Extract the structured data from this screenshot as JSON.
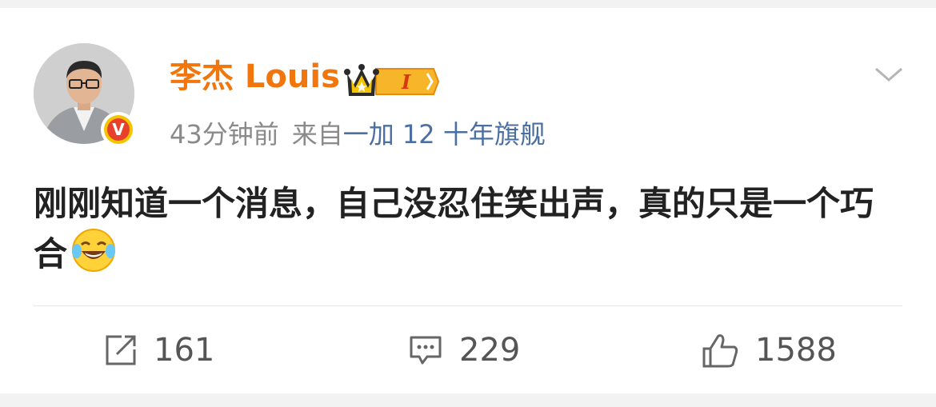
{
  "post": {
    "author": "李杰 Louis",
    "vip_level": "I",
    "time": "43分钟前",
    "source_prefix": "来自",
    "device": "一加 12 十年旗舰",
    "text": "刚刚知道一个消息，自己没忍住笑出声，真的只是一个巧合",
    "verified_badge": "V"
  },
  "actions": {
    "repost_count": "161",
    "comment_count": "229",
    "like_count": "1588"
  },
  "icons": {
    "repost": "share-icon",
    "comment": "comment-icon",
    "like": "thumbs-up-icon",
    "more": "chevron-down-icon",
    "emoji": "laugh-cry-emoji"
  },
  "colors": {
    "username": "#f0760d",
    "device": "#4b6fa0",
    "meta": "#8a8a8a"
  }
}
